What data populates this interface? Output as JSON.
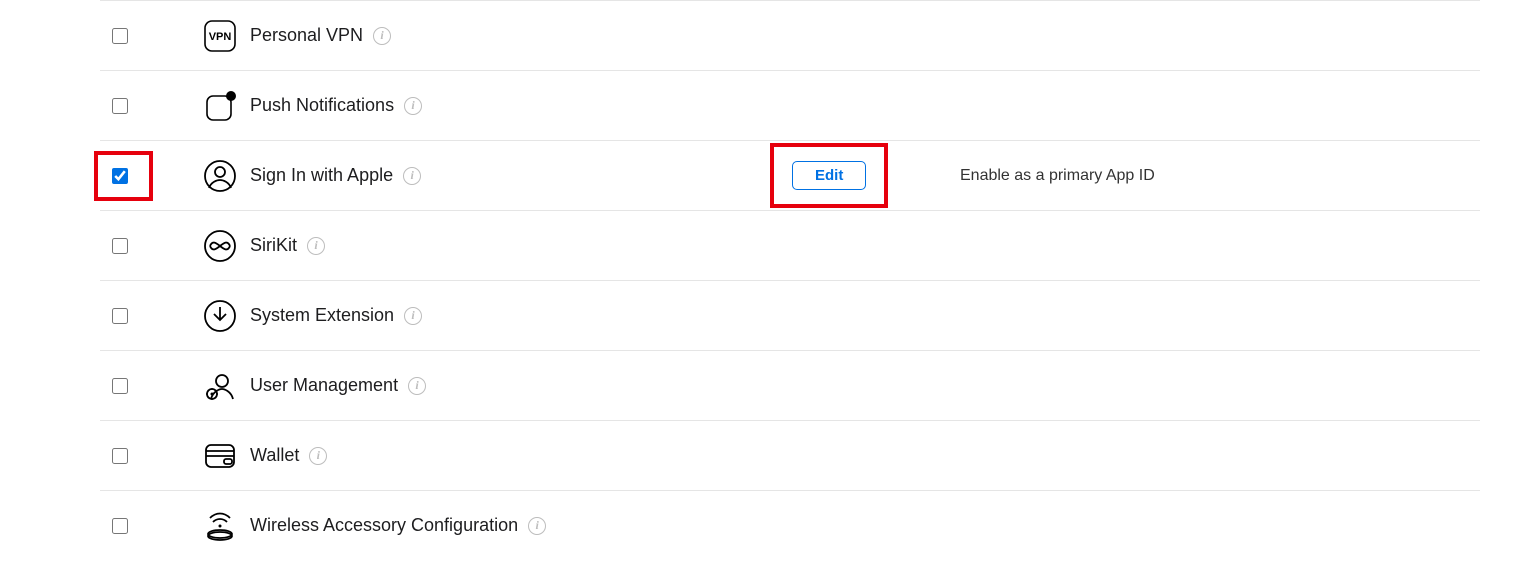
{
  "capabilities": [
    {
      "id": "personal-vpn",
      "label": "Personal VPN",
      "checked": false
    },
    {
      "id": "push-notifications",
      "label": "Push Notifications",
      "checked": false
    },
    {
      "id": "sign-in-with-apple",
      "label": "Sign In with Apple",
      "checked": true,
      "editLabel": "Edit",
      "status": "Enable as a primary App ID"
    },
    {
      "id": "sirikit",
      "label": "SiriKit",
      "checked": false
    },
    {
      "id": "system-extension",
      "label": "System Extension",
      "checked": false
    },
    {
      "id": "user-management",
      "label": "User Management",
      "checked": false
    },
    {
      "id": "wallet",
      "label": "Wallet",
      "checked": false
    },
    {
      "id": "wireless-accessory-configuration",
      "label": "Wireless Accessory Configuration",
      "checked": false
    }
  ]
}
